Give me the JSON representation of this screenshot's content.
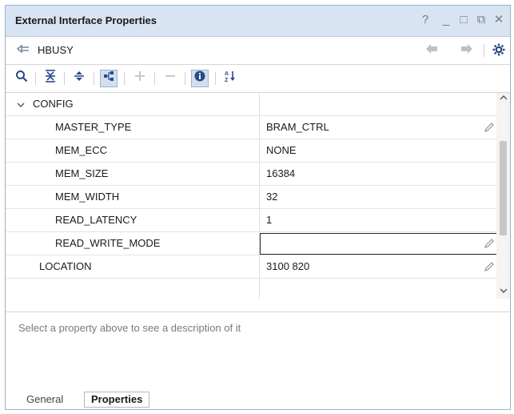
{
  "window": {
    "title": "External Interface Properties",
    "controls": [
      "?",
      "_",
      "□",
      "⧉",
      "✕"
    ]
  },
  "interface": {
    "name": "HBUSY"
  },
  "grid": {
    "rows": [
      {
        "name": "CONFIG",
        "value": "",
        "group": true
      },
      {
        "name": "MASTER_TYPE",
        "value": "BRAM_CTRL",
        "editable": true
      },
      {
        "name": "MEM_ECC",
        "value": "NONE"
      },
      {
        "name": "MEM_SIZE",
        "value": "16384"
      },
      {
        "name": "MEM_WIDTH",
        "value": "32"
      },
      {
        "name": "READ_LATENCY",
        "value": "1"
      },
      {
        "name": "READ_WRITE_MODE",
        "value": "",
        "editing": true,
        "editable": true
      },
      {
        "name": "LOCATION",
        "value": "3100 820",
        "editable": true
      }
    ]
  },
  "description": {
    "placeholder": "Select a property above to see a description of it"
  },
  "tabs": [
    {
      "label": "General",
      "active": false
    },
    {
      "label": "Properties",
      "active": true
    }
  ],
  "colors": {
    "titlebar": "#d9e4f2",
    "toolbar_icon": "#2b4a86",
    "accent_active": "#d3dff0"
  }
}
